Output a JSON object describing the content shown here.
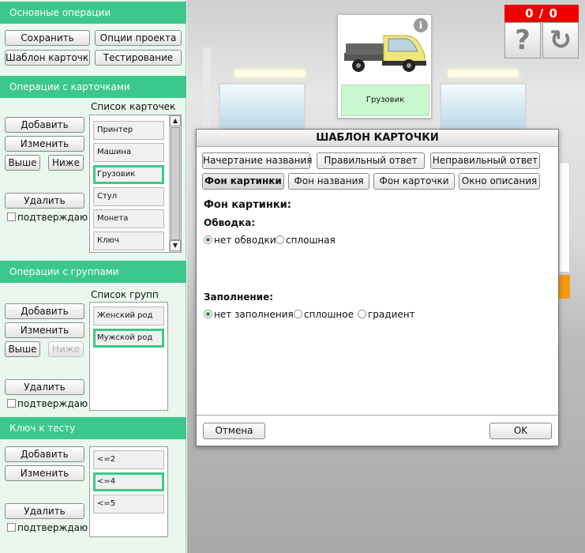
{
  "sections": {
    "basic": {
      "title": "Основные операции",
      "save": "Сохранить",
      "project_options": "Опции проекта",
      "card_template": "Шаблон карточки",
      "testing": "Тестирование"
    },
    "cards": {
      "title": "Операции с карточками",
      "list_title": "Список карточек",
      "add": "Добавить",
      "edit": "Изменить",
      "up": "Выше",
      "down": "Ниже",
      "delete": "Удалить",
      "confirm": "подтверждаю",
      "items": [
        "Принтер",
        "Машина",
        "Грузовик",
        "Стул",
        "Монета",
        "Ключ"
      ],
      "selected": "Грузовик"
    },
    "groups": {
      "title": "Операции с группами",
      "list_title": "Список групп",
      "add": "Добавить",
      "edit": "Изменить",
      "up": "Выше",
      "down": "Ниже",
      "delete": "Удалить",
      "confirm": "подтверждаю",
      "items": [
        "Женский род",
        "Мужской род"
      ],
      "selected": "Мужской род"
    },
    "key": {
      "title": "Ключ к тесту",
      "add": "Добавить",
      "edit": "Изменить",
      "delete": "Удалить",
      "confirm": "подтверждаю",
      "items": [
        "<=2",
        "<=4",
        "<=5"
      ],
      "selected": "<=4"
    }
  },
  "scene": {
    "card_caption": "Грузовик",
    "info_glyph": "i",
    "score": "0 / 0",
    "help_glyph": "?",
    "refresh_glyph": "↻"
  },
  "dialog": {
    "title": "ШАБЛОН КАРТОЧКИ",
    "tabs_row1": [
      "Начертание названия",
      "Правильный ответ",
      "Неправильный ответ"
    ],
    "tabs_row2": [
      "Фон картинки",
      "Фон названия",
      "Фон карточки",
      "Окно описания"
    ],
    "active_tab": "Фон картинки",
    "heading": "Фон картинки:",
    "border_label": "Обводка:",
    "border_options": [
      "нет обводки",
      "сплошная"
    ],
    "border_selected": "нет обводки",
    "fill_label": "Заполнение:",
    "fill_options": [
      "нет заполнения",
      "сплошное",
      "градиент"
    ],
    "fill_selected": "нет заполнения",
    "cancel": "Отмена",
    "ok": "OK"
  },
  "colors": {
    "accent": "#3cc88c",
    "panel_bg": "#e9f7ee",
    "score_bg": "#ee0000",
    "card_caption_bg": "#c9f7cf"
  }
}
